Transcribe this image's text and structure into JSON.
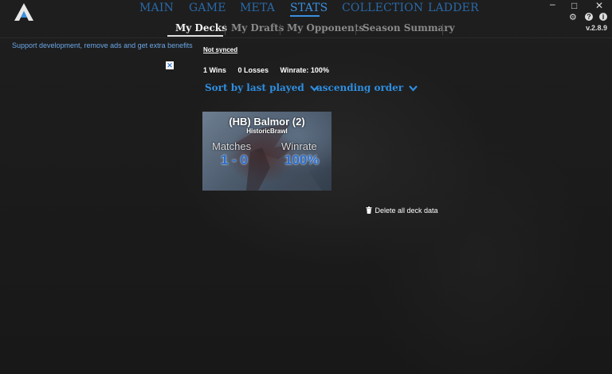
{
  "topnav": {
    "items": [
      {
        "label": "MAIN"
      },
      {
        "label": "GAME"
      },
      {
        "label": "META"
      },
      {
        "label": "STATS"
      },
      {
        "label": "COLLECTION"
      },
      {
        "label": "LADDER"
      }
    ],
    "active": "STATS"
  },
  "window_controls": {
    "minimize": "–",
    "maximize": "□",
    "close": "✕"
  },
  "tools": {
    "settings": "⚙",
    "help": "?",
    "info": "i"
  },
  "version": "v.2.8.9",
  "subnav": {
    "tabs": [
      {
        "label": "My Decks"
      },
      {
        "label": "My Drafts"
      },
      {
        "label": "My Opponents"
      },
      {
        "label": "Season Summary"
      }
    ],
    "active": "My Decks"
  },
  "sidebar": {
    "support_text": "Support development, remove ads and get extra benefits",
    "ad_close": "✕"
  },
  "main": {
    "sync_status": "Not synced",
    "summary": {
      "wins": "1 Wins",
      "losses": "0 Losses",
      "winrate": "Winrate: 100%"
    },
    "sort_by": "Sort by last played",
    "order": "ascending order",
    "decks": [
      {
        "name": "(HB) Balmor (2)",
        "format": "HistoricBrawl",
        "matches_label": "Matches",
        "matches_value": "1 - 0",
        "winrate_label": "Winrate",
        "winrate_value": "100%"
      }
    ],
    "delete_label": "Delete all deck data"
  },
  "colors": {
    "accent": "#3a8fe0",
    "nav": "#2a69a8",
    "background": "#1c1c1c"
  }
}
